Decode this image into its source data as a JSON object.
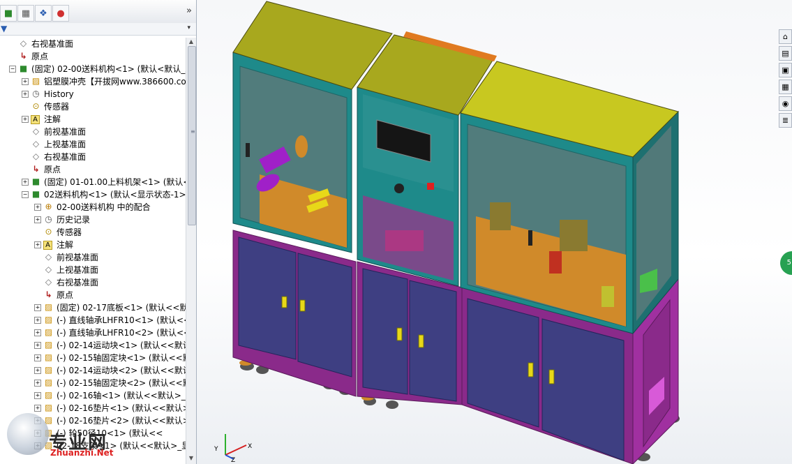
{
  "toolbar": {
    "buttons": [
      "feature-manager",
      "property-manager",
      "configuration-manager",
      "display-manager"
    ],
    "more": "»"
  },
  "filter": {
    "dropdown": "▾"
  },
  "tree": [
    {
      "depth": 0,
      "exp": "",
      "icon": "plane",
      "label": "右视基准面"
    },
    {
      "depth": 0,
      "exp": "",
      "icon": "origin",
      "label": "原点"
    },
    {
      "depth": 0,
      "exp": "−",
      "icon": "asm",
      "label": "(固定) 02-00送料机构<1> (默认<默认_显示"
    },
    {
      "depth": 1,
      "exp": "+",
      "icon": "part",
      "label": "铝塑膜冲壳【开拔网www.386600.com】"
    },
    {
      "depth": 1,
      "exp": "+",
      "icon": "hist",
      "label": "History"
    },
    {
      "depth": 1,
      "exp": "",
      "icon": "sens",
      "label": "传感器"
    },
    {
      "depth": 1,
      "exp": "+",
      "icon": "note",
      "label": "注解"
    },
    {
      "depth": 1,
      "exp": "",
      "icon": "plane",
      "label": "前视基准面"
    },
    {
      "depth": 1,
      "exp": "",
      "icon": "plane",
      "label": "上视基准面"
    },
    {
      "depth": 1,
      "exp": "",
      "icon": "plane",
      "label": "右视基准面"
    },
    {
      "depth": 1,
      "exp": "",
      "icon": "origin",
      "label": "原点"
    },
    {
      "depth": 1,
      "exp": "+",
      "icon": "asm",
      "label": "(固定) 01-01.00上料机架<1> (默认<默认"
    },
    {
      "depth": 1,
      "exp": "−",
      "icon": "asm",
      "label": "02送料机构<1> (默认<显示状态-1>)"
    },
    {
      "depth": 2,
      "exp": "+",
      "icon": "mate",
      "label": "02-00送料机构 中的配合"
    },
    {
      "depth": 2,
      "exp": "+",
      "icon": "hist",
      "label": "历史记录"
    },
    {
      "depth": 2,
      "exp": "",
      "icon": "sens",
      "label": "传感器"
    },
    {
      "depth": 2,
      "exp": "+",
      "icon": "note",
      "label": "注解"
    },
    {
      "depth": 2,
      "exp": "",
      "icon": "plane",
      "label": "前视基准面"
    },
    {
      "depth": 2,
      "exp": "",
      "icon": "plane",
      "label": "上视基准面"
    },
    {
      "depth": 2,
      "exp": "",
      "icon": "plane",
      "label": "右视基准面"
    },
    {
      "depth": 2,
      "exp": "",
      "icon": "origin",
      "label": "原点"
    },
    {
      "depth": 2,
      "exp": "+",
      "icon": "part",
      "label": "(固定) 02-17底板<1> (默认<<默认>"
    },
    {
      "depth": 2,
      "exp": "+",
      "icon": "part",
      "label": "(-) 直线轴承LHFR10<1> (默认<<默"
    },
    {
      "depth": 2,
      "exp": "+",
      "icon": "part",
      "label": "(-) 直线轴承LHFR10<2> (默认<<默"
    },
    {
      "depth": 2,
      "exp": "+",
      "icon": "part",
      "label": "(-) 02-14运动块<1> (默认<<默认>_"
    },
    {
      "depth": 2,
      "exp": "+",
      "icon": "part",
      "label": "(-) 02-15轴固定块<1> (默认<<默认"
    },
    {
      "depth": 2,
      "exp": "+",
      "icon": "part",
      "label": "(-) 02-14运动块<2> (默认<<默认>_"
    },
    {
      "depth": 2,
      "exp": "+",
      "icon": "part",
      "label": "(-) 02-15轴固定块<2> (默认<<默认"
    },
    {
      "depth": 2,
      "exp": "+",
      "icon": "part",
      "label": "(-) 02-16轴<1> (默认<<默认>_显示"
    },
    {
      "depth": 2,
      "exp": "+",
      "icon": "part",
      "label": "(-) 02-16垫片<1> (默认<<默认>_显"
    },
    {
      "depth": 2,
      "exp": "+",
      "icon": "part",
      "label": "(-) 02-16垫片<2> (默认<<默认>_显"
    },
    {
      "depth": 2,
      "exp": "+",
      "icon": "part",
      "label": "(-) 轮50径10<1> (默认<<"
    },
    {
      "depth": 2,
      "exp": "+",
      "icon": "part",
      "label": "02-18支架<1> (默认<<默认>_显示"
    }
  ],
  "task_pane": [
    "design-library-icon",
    "toolbox-icon",
    "file-explorer-icon",
    "view-palette-icon",
    "appearances-icon",
    "custom-properties-icon"
  ],
  "badge": {
    "text": "5"
  },
  "triad": {
    "x": "X",
    "y": "Y",
    "z": "Z"
  },
  "watermark": {
    "text": "专业网",
    "url": "Zhuanzhi.Net"
  },
  "colors": {
    "top_panel": "#a8a81e",
    "frame": "#1e8a8a",
    "cabinet_door": "#3e3f82",
    "cabinet_frame": "#8a2a8a",
    "door_handle": "#e8d818",
    "roller": "#a020c8",
    "plate": "#d08a2a"
  }
}
